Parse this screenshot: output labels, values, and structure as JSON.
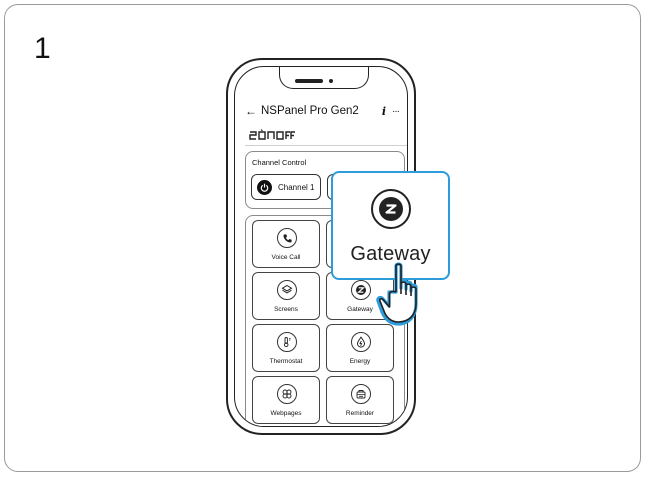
{
  "step_number": "1",
  "phone": {
    "header": {
      "back_arrow": "←",
      "title": "NSPanel Pro Gen2",
      "info_icon": "i",
      "more_icon": "···"
    },
    "brand_logo": "SONOFF",
    "channel_control": {
      "title": "Channel Control",
      "channels": [
        {
          "label": "Channel 1",
          "icon": "power-icon"
        },
        {
          "label": "",
          "icon": "power-icon"
        }
      ]
    },
    "tiles": [
      {
        "label": "Voice Call",
        "icon": "phone-icon"
      },
      {
        "label": "",
        "icon": ""
      },
      {
        "label": "Screens",
        "icon": "layers-icon"
      },
      {
        "label": "Gateway",
        "icon": "zigbee-icon"
      },
      {
        "label": "Thermostat",
        "icon": "thermostat-icon"
      },
      {
        "label": "Energy",
        "icon": "energy-icon"
      },
      {
        "label": "Webpages",
        "icon": "grid-flower-icon"
      },
      {
        "label": "Reminder",
        "icon": "reminder-icon"
      }
    ]
  },
  "popup": {
    "label": "Gateway",
    "icon": "zigbee-icon"
  },
  "colors": {
    "highlight": "#2d9cdb",
    "outline": "#222222",
    "frame": "#9a9a9a"
  }
}
